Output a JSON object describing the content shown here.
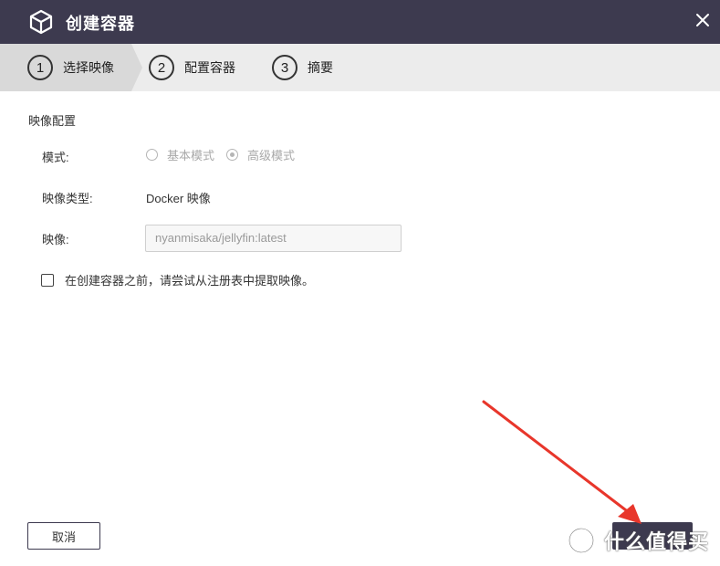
{
  "window": {
    "title": "创建容器",
    "title_icon": "cube-icon",
    "close_icon": "close-icon"
  },
  "steps": [
    {
      "number": "1",
      "label": "选择映像",
      "active": true
    },
    {
      "number": "2",
      "label": "配置容器",
      "active": false
    },
    {
      "number": "3",
      "label": "摘要",
      "active": false
    }
  ],
  "image_config": {
    "section_title": "映像配置",
    "mode_label": "模式:",
    "mode_options": [
      {
        "label": "基本模式",
        "selected": false
      },
      {
        "label": "高级模式",
        "selected": true
      }
    ],
    "image_type_label": "映像类型:",
    "image_type_value": "Docker 映像",
    "image_label": "映像:",
    "image_value": "nyanmisaka/jellyfin:latest",
    "pull_checkbox_label": "在创建容器之前，请尝试从注册表中提取映像。",
    "pull_checkbox_checked": false
  },
  "footer": {
    "cancel_label": "取消"
  },
  "watermark": {
    "text": "什么值得买"
  },
  "colors": {
    "title_bar": "#3d3a4f",
    "step_bar": "#ececec",
    "annotation_arrow": "#e8362b"
  }
}
